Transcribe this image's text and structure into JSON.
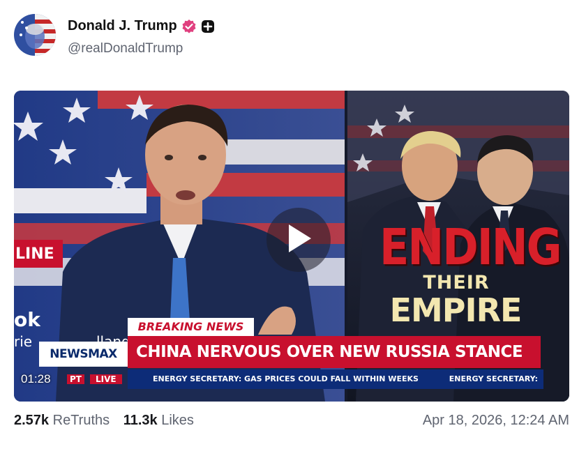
{
  "post": {
    "author": {
      "display_name": "Donald J. Trump",
      "handle": "@realDonaldTrump",
      "verified_icon": "verified-badge-icon",
      "plus_icon": "plus-square-icon",
      "verified_color": "#e0407f"
    },
    "video": {
      "duration": "01:28",
      "overlay": {
        "ending": "ENDING",
        "their": "THEIR",
        "empire": "EMPIRE",
        "breaking_news": "BREAKING NEWS",
        "headline": "CHINA NERVOUS OVER NEW RUSSIA STANCE",
        "network_logo": "NEWSMAX",
        "ticker": "ENERGY SECRETARY: GAS PRICES COULD FALL WITHIN WEEKS",
        "ticker_repeat": "ENERGY SECRETARY:",
        "pt_label": "PT",
        "live_label": "LIVE",
        "left_fragment_1": "LINE",
        "left_fragment_2": "ok",
        "left_fragment_3": "rie",
        "left_fragment_4": "lland"
      },
      "colors": {
        "headline_red": "#c8102e",
        "ticker_blue": "#0d2c78",
        "ending_red": "#d8202a",
        "empire_cream": "#f3e7b0"
      }
    },
    "stats": {
      "retruths_count": "2.57k",
      "retruths_label": "ReTruths",
      "likes_count": "11.3k",
      "likes_label": "Likes"
    },
    "timestamp": "Apr 18, 2026, 12:24 AM"
  }
}
